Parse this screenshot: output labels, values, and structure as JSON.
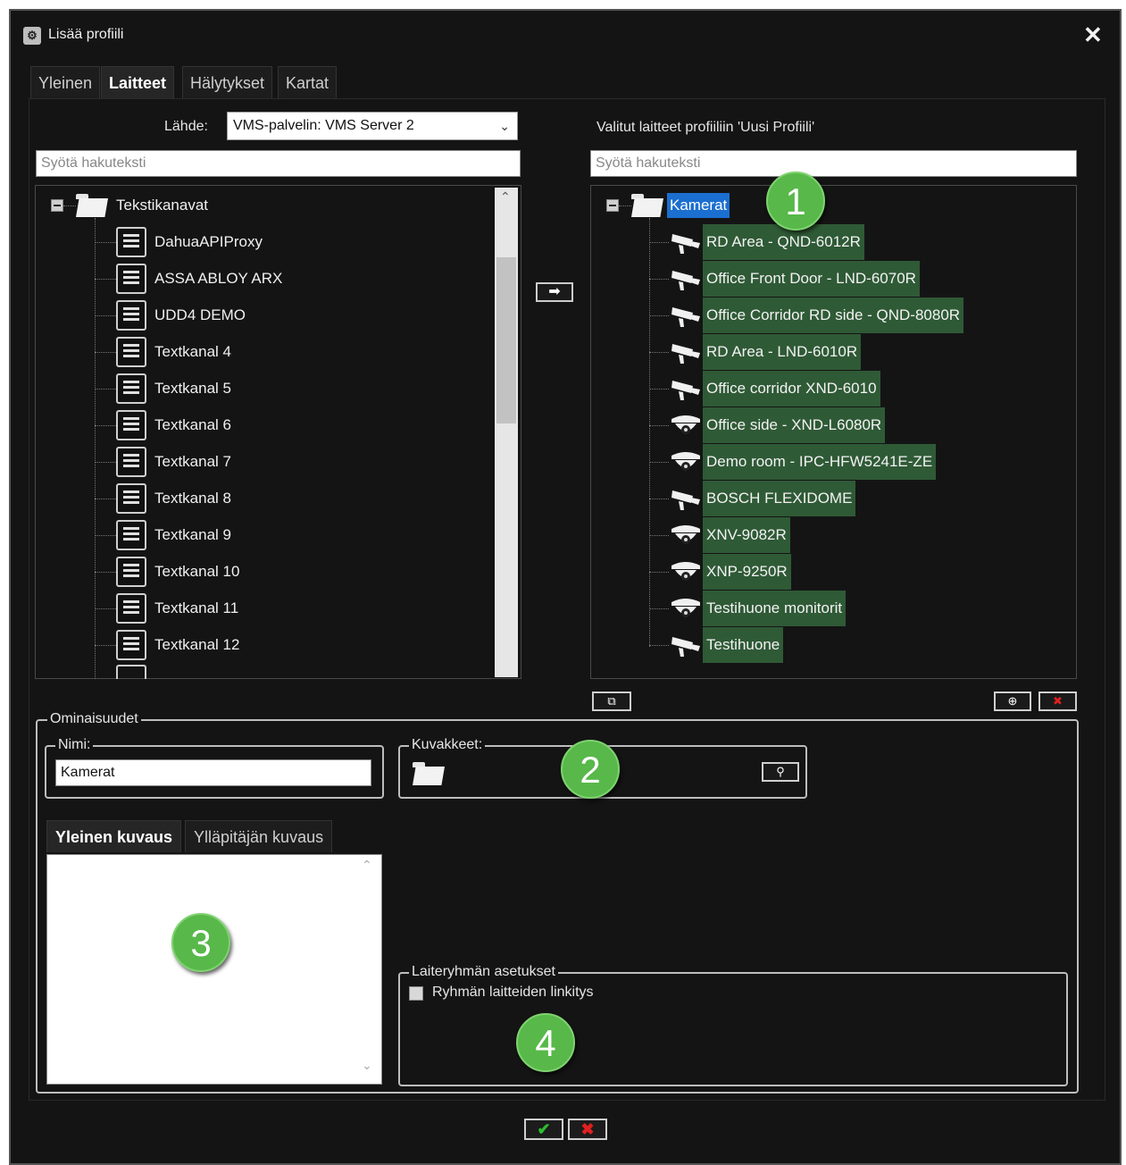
{
  "window": {
    "title": "Lisää profiili",
    "close_glyph": "✕"
  },
  "tabs": [
    {
      "label": "Yleinen"
    },
    {
      "label": "Laitteet"
    },
    {
      "label": "Hälytykset"
    },
    {
      "label": "Kartat"
    }
  ],
  "source": {
    "label": "Lähde:",
    "value": "VMS-palvelin: VMS Server 2"
  },
  "left_search": {
    "placeholder": "Syötä hakuteksti"
  },
  "left_tree": {
    "root": "Tekstikanavat",
    "items": [
      "DahuaAPIProxy",
      "ASSA ABLOY ARX",
      "UDD4 DEMO",
      "Textkanal 4",
      "Textkanal 5",
      "Textkanal 6",
      "Textkanal 7",
      "Textkanal 8",
      "Textkanal 9",
      "Textkanal 10",
      "Textkanal 11",
      "Textkanal 12"
    ]
  },
  "right_heading": "Valitut laitteet profiiliin 'Uusi Profiili'",
  "right_search": {
    "placeholder": "Syötä hakuteksti"
  },
  "right_tree": {
    "root": "Kamerat",
    "items": [
      {
        "label": "RD Area - QND-6012R",
        "icon": "bullet-camera-icon"
      },
      {
        "label": "Office Front Door - LND-6070R",
        "icon": "bullet-camera-icon"
      },
      {
        "label": "Office Corridor RD side - QND-8080R",
        "icon": "bullet-camera-icon"
      },
      {
        "label": "RD Area - LND-6010R",
        "icon": "bullet-camera-icon"
      },
      {
        "label": "Office corridor XND-6010",
        "icon": "bullet-camera-icon"
      },
      {
        "label": "Office side - XND-L6080R",
        "icon": "dome-camera-icon"
      },
      {
        "label": "Demo room - IPC-HFW5241E-ZE",
        "icon": "dome-camera-icon"
      },
      {
        "label": "BOSCH FLEXIDOME",
        "icon": "bullet-camera-icon"
      },
      {
        "label": "XNV-9082R",
        "icon": "dome-camera-icon"
      },
      {
        "label": "XNP-9250R",
        "icon": "dome-camera-icon"
      },
      {
        "label": "Testihuone monitorit",
        "icon": "dome-camera-icon"
      },
      {
        "label": "Testihuone",
        "icon": "bullet-camera-icon"
      }
    ]
  },
  "properties": {
    "legend": "Ominaisuudet",
    "name_legend": "Nimi:",
    "name_value": "Kamerat",
    "icons_legend": "Kuvakkeet:",
    "desc_tabs": [
      "Yleinen kuvaus",
      "Ylläpitäjän kuvaus"
    ],
    "group_legend": "Laiteryhmän asetukset",
    "group_checkbox": "Ryhmän laitteiden linkitys"
  },
  "badges": [
    "1",
    "2",
    "3",
    "4"
  ],
  "colors": {
    "accent_selected": "#1b6fd0",
    "row_highlight": "#2f5a36",
    "badge": "#58b84a",
    "ok": "#2fbd2f",
    "cancel": "#e02020"
  },
  "buttons": {
    "ok": "✔",
    "cancel": "✖",
    "move_right": "➡"
  }
}
